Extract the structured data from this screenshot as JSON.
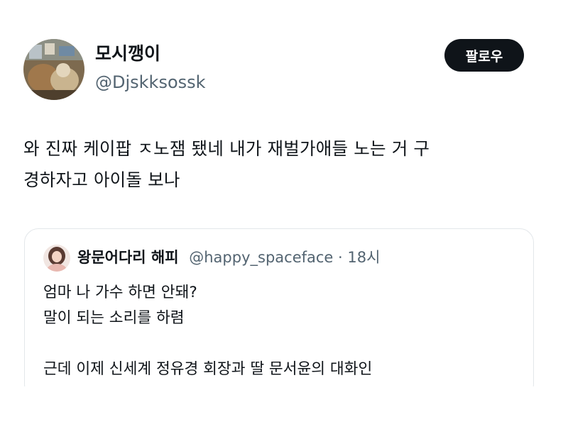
{
  "author": {
    "display_name": "모시깽이",
    "handle": "@Djskksossk"
  },
  "follow_button": {
    "label": "팔로우"
  },
  "tweet": {
    "lines": [
      "와 진짜 케이팝 ㅈ노잼 됐네 내가 재벌가애들 노는 거 구",
      "경하자고 아이돌 보나"
    ]
  },
  "quoted_tweet": {
    "display_name": "왕문어다리 해피",
    "handle": "@happy_spaceface",
    "separator": "·",
    "time": "18시",
    "lines": [
      "엄마 나 가수 하면 안돼?",
      "말이 되는 소리를 하렴",
      "",
      "근데 이제 신세계 정유경 회장과 딸 문서윤의 대화인"
    ]
  },
  "colors": {
    "text_primary": "#0f1419",
    "text_secondary": "#536471",
    "button_bg": "#0f1419",
    "border": "#e3e7ea"
  }
}
